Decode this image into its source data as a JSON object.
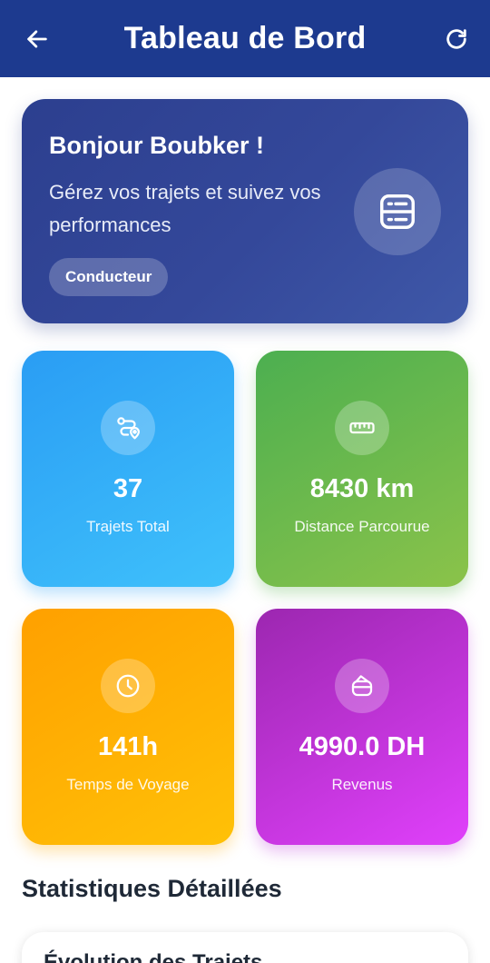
{
  "appbar": {
    "title": "Tableau de Bord",
    "back_icon": "arrow-left-icon",
    "refresh_icon": "refresh-icon",
    "color": "#1d3a8f"
  },
  "welcome": {
    "greeting": "Bonjour Boubker !",
    "subtitle": "Gérez vos trajets et suivez vos performances",
    "role": "Conducteur",
    "icon": "dashboard-icon"
  },
  "stats": {
    "trips": {
      "value": "37",
      "label": "Trajets Total",
      "icon": "route-icon",
      "color": "#2a9df4"
    },
    "distance": {
      "value": "8430 km",
      "label": "Distance Parcourue",
      "icon": "ruler-icon",
      "color": "#4caf50"
    },
    "time": {
      "value": "141h",
      "label": "Temps de Voyage",
      "icon": "clock-icon",
      "color": "#ffa000"
    },
    "revenue": {
      "value": "4990.0 DH",
      "label": "Revenus",
      "icon": "wallet-icon",
      "color": "#9c27b0"
    }
  },
  "details": {
    "section_title": "Statistiques Détaillées",
    "chart_title": "Évolution des Trajets"
  }
}
